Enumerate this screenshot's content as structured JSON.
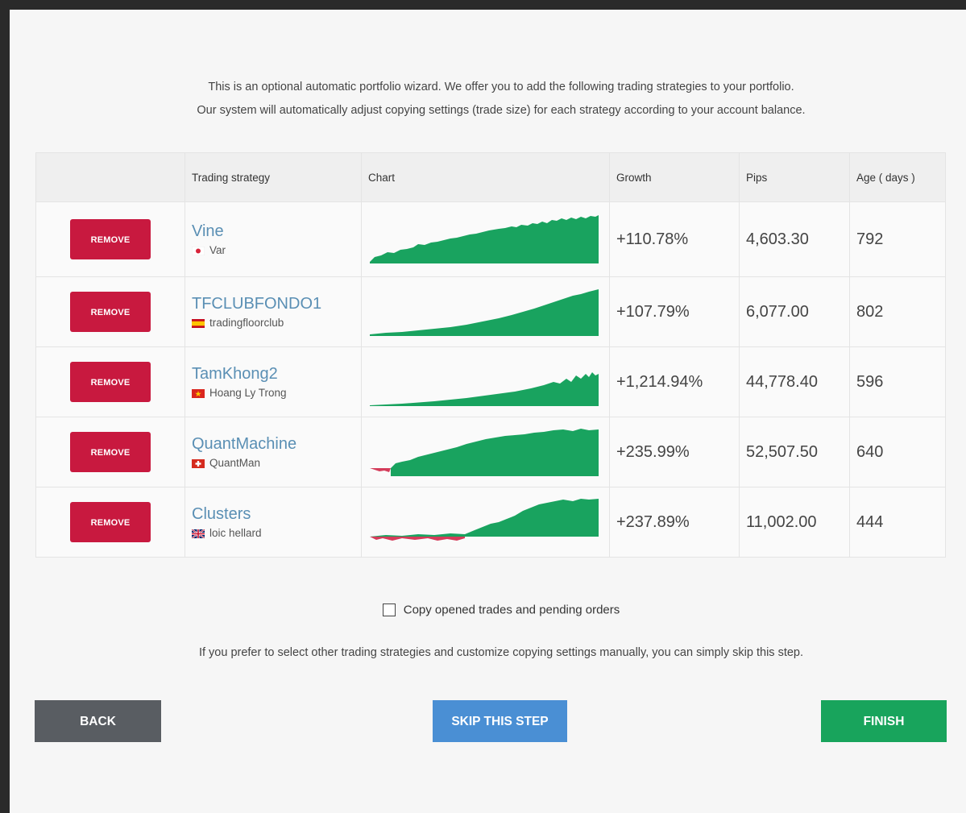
{
  "intro": {
    "line1": "This is an optional automatic portfolio wizard. We offer you to add the following trading strategies to your portfolio.",
    "line2": "Our system will automatically adjust copying settings (trade size) for each strategy according to your account balance."
  },
  "table": {
    "headers": {
      "strategy": "Trading strategy",
      "chart": "Chart",
      "growth": "Growth",
      "pips": "Pips",
      "age": "Age ( days )"
    },
    "remove_label": "REMOVE",
    "rows": [
      {
        "name": "Vine",
        "owner": "Var",
        "flag": "japan",
        "growth": "+110.78%",
        "pips": "4,603.30",
        "age": "792"
      },
      {
        "name": "TFCLUBFONDO1",
        "owner": "tradingfloorclub",
        "flag": "spain",
        "growth": "+107.79%",
        "pips": "6,077.00",
        "age": "802"
      },
      {
        "name": "TamKhong2",
        "owner": "Hoang Ly Trong",
        "flag": "vietnam",
        "growth": "+1,214.94%",
        "pips": "44,778.40",
        "age": "596"
      },
      {
        "name": "QuantMachine",
        "owner": "QuantMan",
        "flag": "switzerland",
        "growth": "+235.99%",
        "pips": "52,507.50",
        "age": "640"
      },
      {
        "name": "Clusters",
        "owner": "loic hellard",
        "flag": "uk",
        "growth": "+237.89%",
        "pips": "11,002.00",
        "age": "444"
      }
    ]
  },
  "copy_option": {
    "label": "Copy opened trades and pending orders",
    "checked": false
  },
  "skip_note": "If you prefer to select other trading strategies and customize copying settings manually, you can simply skip this step.",
  "buttons": {
    "back": "BACK",
    "skip": "SKIP THIS STEP",
    "finish": "FINISH"
  },
  "colors": {
    "remove": "#c8193f",
    "growth_fill": "#19a35f",
    "loss_fill": "#d43c5a",
    "name_link": "#5a8fb4",
    "back": "#595d62",
    "skip": "#4a8fd4",
    "finish": "#18a45c"
  }
}
